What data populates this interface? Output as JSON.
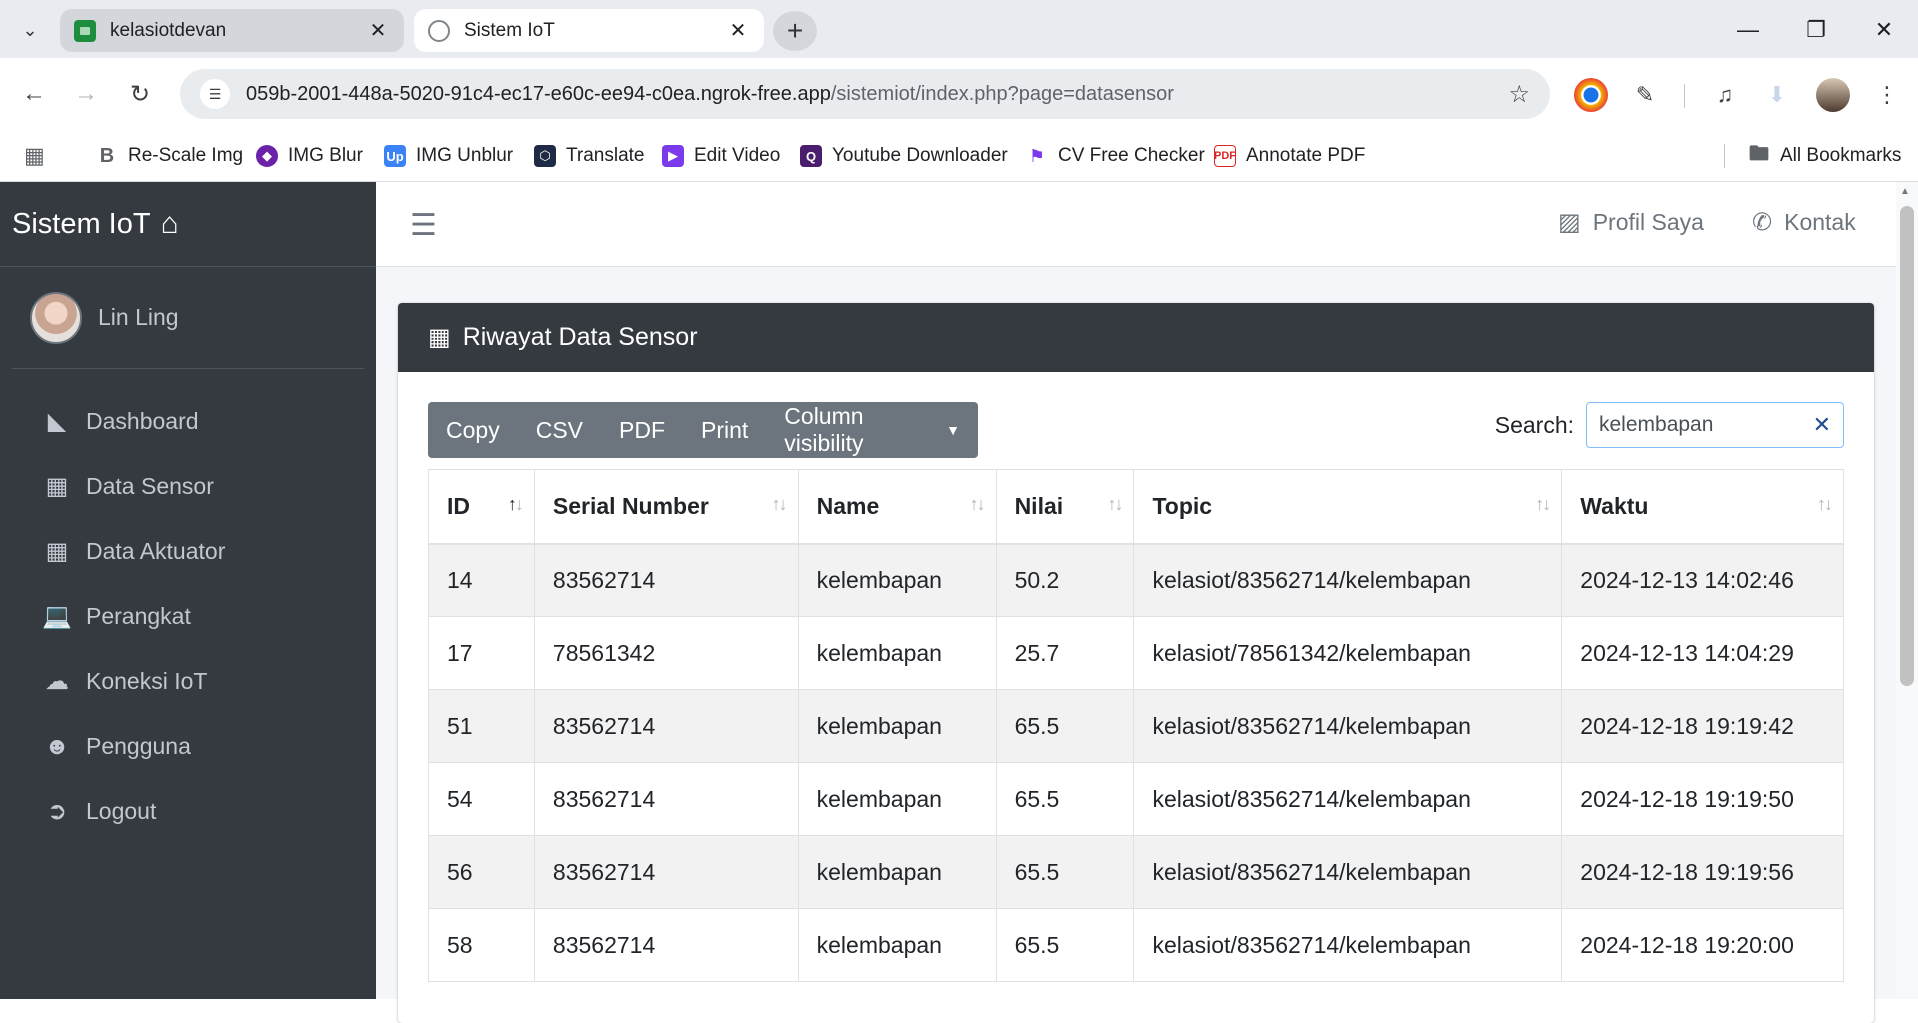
{
  "browser": {
    "tabs": [
      {
        "title": "kelasiotdevan",
        "icon": "sheets-icon"
      },
      {
        "title": "Sistem IoT",
        "icon": "globe-icon"
      }
    ],
    "url_host": "059b-2001-448a-5020-91c4-ec17-e60c-ee94-c0ea.ngrok-free.app",
    "url_path": "/sistemiot/index.php?page=datasensor",
    "bookmarks": [
      "Re-Scale Img",
      "IMG Blur",
      "IMG Unblur",
      "Translate",
      "Edit Video",
      "Youtube Downloader",
      "CV Free Checker",
      "Annotate PDF"
    ],
    "all_bookmarks": "All Bookmarks"
  },
  "sidebar": {
    "brand": "Sistem IoT",
    "user": "Lin Ling",
    "items": [
      {
        "label": "Dashboard",
        "icon": "chart-area-icon"
      },
      {
        "label": "Data Sensor",
        "icon": "grid-icon"
      },
      {
        "label": "Data Aktuator",
        "icon": "grid-icon"
      },
      {
        "label": "Perangkat",
        "icon": "laptop-icon"
      },
      {
        "label": "Koneksi IoT",
        "icon": "cloud-icon"
      },
      {
        "label": "Pengguna",
        "icon": "users-icon"
      },
      {
        "label": "Logout",
        "icon": "sign-out-icon"
      }
    ]
  },
  "topnav": {
    "profile": "Profil Saya",
    "contact": "Kontak"
  },
  "card": {
    "title": "Riwayat Data Sensor",
    "buttons": {
      "copy": "Copy",
      "csv": "CSV",
      "pdf": "PDF",
      "print": "Print",
      "colvis": "Column visibility"
    },
    "search_label": "Search:",
    "search_value": "kelembapan"
  },
  "table": {
    "headers": [
      "ID",
      "Serial Number",
      "Name",
      "Nilai",
      "Topic",
      "Waktu"
    ],
    "rows": [
      [
        "14",
        "83562714",
        "kelembapan",
        "50.2",
        "kelasiot/83562714/kelembapan",
        "2024-12-13 14:02:46"
      ],
      [
        "17",
        "78561342",
        "kelembapan",
        "25.7",
        "kelasiot/78561342/kelembapan",
        "2024-12-13 14:04:29"
      ],
      [
        "51",
        "83562714",
        "kelembapan",
        "65.5",
        "kelasiot/83562714/kelembapan",
        "2024-12-18 19:19:42"
      ],
      [
        "54",
        "83562714",
        "kelembapan",
        "65.5",
        "kelasiot/83562714/kelembapan",
        "2024-12-18 19:19:50"
      ],
      [
        "56",
        "83562714",
        "kelembapan",
        "65.5",
        "kelasiot/83562714/kelembapan",
        "2024-12-18 19:19:56"
      ],
      [
        "58",
        "83562714",
        "kelembapan",
        "65.5",
        "kelasiot/83562714/kelembapan",
        "2024-12-18 19:20:00"
      ]
    ]
  },
  "colors": {
    "sidebar_bg": "#343a40",
    "button_group_bg": "#6c757d",
    "page_bg": "#f4f6f9"
  }
}
